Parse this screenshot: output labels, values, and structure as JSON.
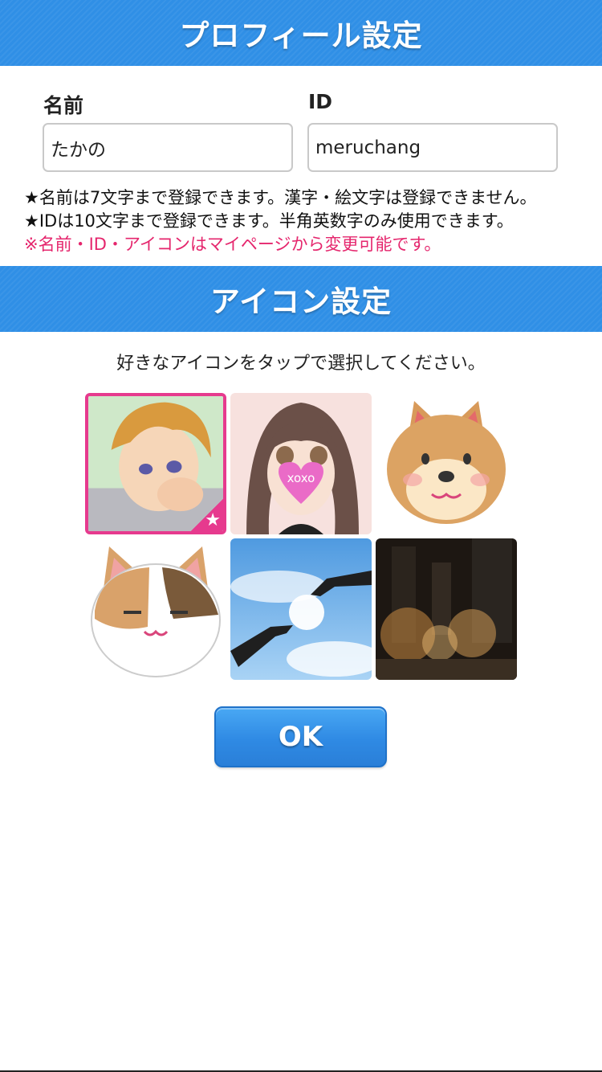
{
  "profile_section": {
    "title": "プロフィール設定",
    "name_label": "名前",
    "name_value": "たかの",
    "id_label": "ID",
    "id_value": "meruchang"
  },
  "notes": {
    "line1": "★名前は7文字まで登録できます。漢字・絵文字は登録できません。",
    "line2": "★IDは10文字まで登録できます。半角英数字のみ使用できます。",
    "line3": "※名前・ID・アイコンはマイページから変更可能です。"
  },
  "icon_section": {
    "title": "アイコン設定",
    "instruction": "好きなアイコンをタップで選択してください。",
    "icons": [
      {
        "name": "anime-boy-avatar",
        "selected": true,
        "badge": "★"
      },
      {
        "name": "anime-girl-avatar",
        "selected": false,
        "badge_text": "xoxo"
      },
      {
        "name": "shiba-dog-avatar",
        "selected": false
      },
      {
        "name": "calico-cat-avatar",
        "selected": false
      },
      {
        "name": "sky-hands-avatar",
        "selected": false
      },
      {
        "name": "night-city-avatar",
        "selected": false
      }
    ]
  },
  "ok_button": {
    "label": "OK"
  },
  "colors": {
    "header_blue": "#2f8fe6",
    "selected_pink": "#e63a8e",
    "warning_pink": "#e5266d"
  }
}
